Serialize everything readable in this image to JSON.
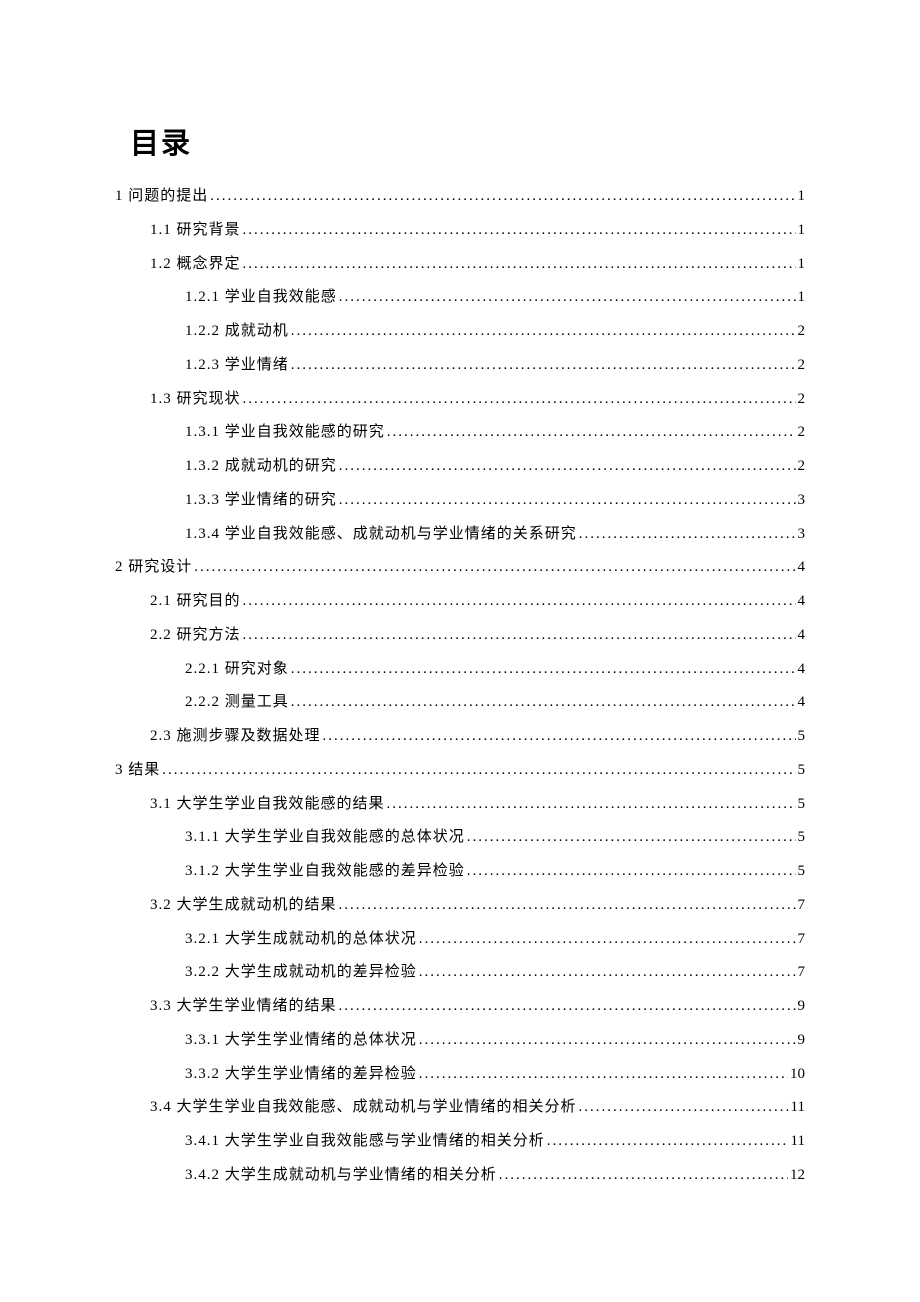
{
  "title": "目录",
  "entries": [
    {
      "level": 1,
      "num": "1",
      "text": "问题的提出",
      "page": "1"
    },
    {
      "level": 2,
      "num": "1.1",
      "text": "研究背景",
      "page": "1"
    },
    {
      "level": 2,
      "num": "1.2",
      "text": "概念界定",
      "page": "1"
    },
    {
      "level": 3,
      "num": "1.2.1",
      "text": "学业自我效能感",
      "page": "1"
    },
    {
      "level": 3,
      "num": "1.2.2",
      "text": "成就动机",
      "page": "2"
    },
    {
      "level": 3,
      "num": "1.2.3",
      "text": "学业情绪",
      "page": "2"
    },
    {
      "level": 2,
      "num": "1.3",
      "text": "研究现状",
      "page": "2"
    },
    {
      "level": 3,
      "num": "1.3.1",
      "text": "学业自我效能感的研究",
      "page": "2"
    },
    {
      "level": 3,
      "num": "1.3.2",
      "text": "成就动机的研究",
      "page": "2"
    },
    {
      "level": 3,
      "num": "1.3.3",
      "text": "学业情绪的研究",
      "page": "3"
    },
    {
      "level": 3,
      "num": "1.3.4",
      "text": "学业自我效能感、成就动机与学业情绪的关系研究",
      "page": "3"
    },
    {
      "level": 1,
      "num": "2",
      "text": "研究设计",
      "page": "4"
    },
    {
      "level": 2,
      "num": "2.1",
      "text": "研究目的",
      "page": "4"
    },
    {
      "level": 2,
      "num": "2.2",
      "text": "研究方法",
      "page": "4"
    },
    {
      "level": 3,
      "num": "2.2.1",
      "text": "研究对象",
      "page": "4"
    },
    {
      "level": 3,
      "num": "2.2.2",
      "text": "测量工具",
      "page": "4"
    },
    {
      "level": 2,
      "num": "2.3",
      "text": "施测步骤及数据处理",
      "page": "5"
    },
    {
      "level": 1,
      "num": "3",
      "text": "结果",
      "page": "5"
    },
    {
      "level": 2,
      "num": "3.1",
      "text": "大学生学业自我效能感的结果",
      "page": "5"
    },
    {
      "level": 3,
      "num": "3.1.1",
      "text": "大学生学业自我效能感的总体状况",
      "page": "5"
    },
    {
      "level": 3,
      "num": "3.1.2",
      "text": "大学生学业自我效能感的差异检验",
      "page": "5"
    },
    {
      "level": 2,
      "num": "3.2",
      "text": "大学生成就动机的结果",
      "page": "7"
    },
    {
      "level": 3,
      "num": "3.2.1",
      "text": "大学生成就动机的总体状况",
      "page": "7"
    },
    {
      "level": 3,
      "num": "3.2.2",
      "text": "大学生成就动机的差异检验",
      "page": "7"
    },
    {
      "level": 2,
      "num": "3.3",
      "text": "大学生学业情绪的结果",
      "page": "9"
    },
    {
      "level": 3,
      "num": "3.3.1",
      "text": "大学生学业情绪的总体状况",
      "page": "9"
    },
    {
      "level": 3,
      "num": "3.3.2",
      "text": "大学生学业情绪的差异检验",
      "page": "10"
    },
    {
      "level": 2,
      "num": "3.4",
      "text": "大学生学业自我效能感、成就动机与学业情绪的相关分析",
      "page": "11"
    },
    {
      "level": 3,
      "num": "3.4.1",
      "text": "大学生学业自我效能感与学业情绪的相关分析",
      "page": "11"
    },
    {
      "level": 3,
      "num": "3.4.2",
      "text": "大学生成就动机与学业情绪的相关分析",
      "page": "12"
    }
  ]
}
